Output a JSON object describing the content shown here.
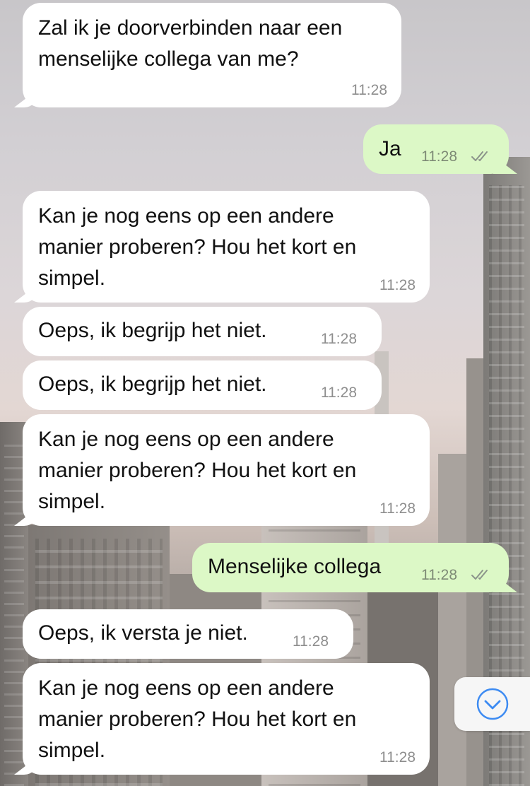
{
  "chat": {
    "messages": [
      {
        "direction": "in",
        "lines": [
          "Zal ik je doorverbinden naar een",
          "menselijke collega van me?"
        ],
        "time": "11:28"
      },
      {
        "direction": "out",
        "lines": [
          "Ja"
        ],
        "time": "11:28",
        "status": "double-check-icon"
      },
      {
        "direction": "in",
        "lines": [
          "Kan je nog eens op een andere",
          "manier proberen? Hou het kort en",
          "simpel."
        ],
        "time": "11:28"
      },
      {
        "direction": "in",
        "lines": [
          "Oeps, ik begrijp het niet."
        ],
        "time": "11:28"
      },
      {
        "direction": "in",
        "lines": [
          "Oeps, ik begrijp het niet."
        ],
        "time": "11:28"
      },
      {
        "direction": "in",
        "lines": [
          "Kan je nog eens op een andere",
          "manier proberen? Hou het kort en",
          "simpel."
        ],
        "time": "11:28"
      },
      {
        "direction": "out",
        "lines": [
          "Menselijke collega"
        ],
        "time": "11:28",
        "status": "double-check-icon"
      },
      {
        "direction": "in",
        "lines": [
          "Oeps, ik versta je niet."
        ],
        "time": "11:28"
      },
      {
        "direction": "in",
        "lines": [
          "Kan je nog eens op een andere",
          "manier proberen? Hou het kort en",
          "simpel."
        ],
        "time": "11:28"
      }
    ]
  },
  "scroll_button": {
    "icon": "chevron-down-circle-icon"
  },
  "colors": {
    "incoming_bubble": "#ffffff",
    "outgoing_bubble": "#dcf8c6",
    "timestamp": "#8e8e8e",
    "scroll_icon": "#3d8bf2"
  }
}
